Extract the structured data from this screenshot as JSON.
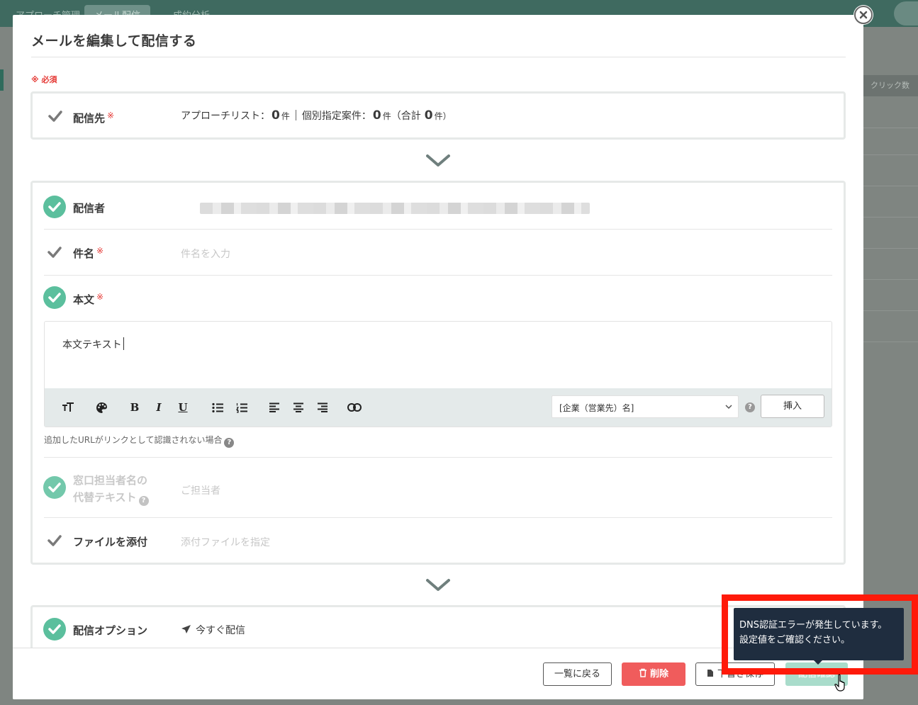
{
  "background": {
    "tabs": [
      "アプローチ管理",
      "メール配信",
      "成約分析"
    ],
    "table_header": "クリック数"
  },
  "modal": {
    "title": "メールを編集して配信する",
    "required_note": "※ 必須",
    "required_mark": "※"
  },
  "recipients": {
    "label": "配信先",
    "approach_list_label": "アプローチリスト：",
    "approach_list_count": "0",
    "individual_label": "個別指定案件：",
    "individual_count": "0",
    "total_prefix": "（合計",
    "total_count": "0",
    "unit": "件",
    "total_suffix": "件）"
  },
  "sender": {
    "label": "配信者"
  },
  "subject": {
    "label": "件名",
    "placeholder": "件名を入力"
  },
  "body": {
    "label": "本文",
    "text": "本文テキスト",
    "merge_field_selected": "[企業（営業先）名]",
    "insert_button": "挿入",
    "url_note": "追加したURLがリンクとして認識されない場合"
  },
  "contact_alt": {
    "label_line1": "窓口担当者名の",
    "label_line2": "代替テキスト",
    "placeholder": "ご担当者"
  },
  "attachment": {
    "label": "ファイルを添付",
    "placeholder": "添付ファイルを指定"
  },
  "delivery_option": {
    "label": "配信オプション",
    "value": "今すぐ配信"
  },
  "footer": {
    "back_button": "一覧に戻る",
    "delete_button": "削除",
    "draft_button": "下書き保存",
    "confirm_button": "配信確認"
  },
  "tooltip": {
    "line1": "DNS認証エラーが発生しています。",
    "line2": "設定値をご確認ください。"
  },
  "colors": {
    "accent_green": "#5bbf9d",
    "danger_red": "#f05c5c",
    "highlight_red": "#ff1a0a",
    "tooltip_bg": "#1f2d3f"
  }
}
